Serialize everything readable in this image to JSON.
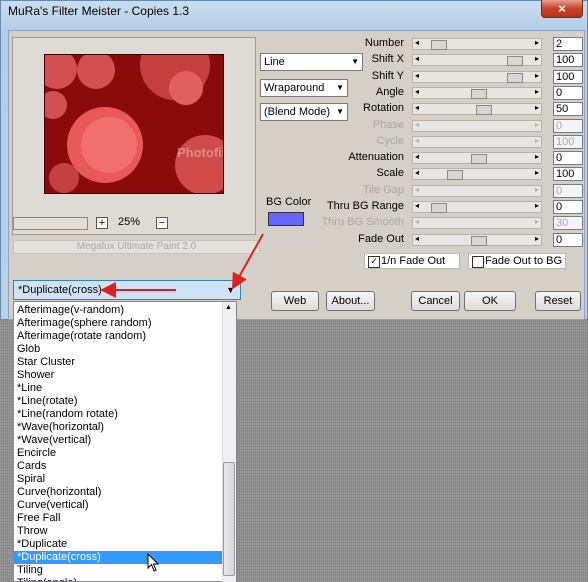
{
  "window": {
    "title": "MuRa's Filter Meister - Copies 1.3",
    "close_glyph": "×"
  },
  "preview": {
    "watermark": "PhotofiltreGraphic",
    "zoom_value": "25%",
    "zoom_plus": "+",
    "zoom_minus": "−",
    "caption": "Megalux Ultimate Paint 2.0"
  },
  "selects": {
    "mode": "Line",
    "edge": "Wraparound",
    "blend": "(Blend Mode)"
  },
  "bg_color": {
    "label": "BG Color",
    "color": "#6666ff"
  },
  "params": [
    {
      "label": "Number",
      "value": "2",
      "pos": 0.08,
      "disabled": false
    },
    {
      "label": "Shift X",
      "value": "100",
      "pos": 0.88,
      "disabled": false
    },
    {
      "label": "Shift Y",
      "value": "100",
      "pos": 0.88,
      "disabled": false
    },
    {
      "label": "Angle",
      "value": "0",
      "pos": 0.5,
      "disabled": false
    },
    {
      "label": "Rotation",
      "value": "50",
      "pos": 0.55,
      "disabled": false
    },
    {
      "label": "Phase",
      "value": "0",
      "pos": null,
      "disabled": true
    },
    {
      "label": "Cycle",
      "value": "100",
      "pos": null,
      "disabled": true
    },
    {
      "label": "Attenuation",
      "value": "0",
      "pos": 0.5,
      "disabled": false
    },
    {
      "label": "Scale",
      "value": "100",
      "pos": 0.25,
      "disabled": false
    },
    {
      "label": "Tile Gap",
      "value": "0",
      "pos": null,
      "disabled": true
    },
    {
      "label": "Thru BG Range",
      "value": "0",
      "pos": 0.08,
      "disabled": false
    },
    {
      "label": "Thru BG Smooth",
      "value": "30",
      "pos": null,
      "disabled": true
    },
    {
      "label": "Fade Out",
      "value": "0",
      "pos": 0.5,
      "disabled": false
    }
  ],
  "checkboxes": {
    "one_n_fade": {
      "label": "1/n Fade Out",
      "checked": true,
      "mark": "✓"
    },
    "fade_to_bg": {
      "label": "Fade Out to BG",
      "checked": false,
      "mark": ""
    }
  },
  "buttons": {
    "web": "Web",
    "about": "About...",
    "cancel": "Cancel",
    "ok": "OK",
    "reset": "Reset"
  },
  "preset_dropdown": {
    "selected": "*Duplicate(cross)"
  },
  "preset_list": [
    "Afterimage(v-random)",
    "Afterimage(sphere random)",
    "Afterimage(rotate random)",
    "Glob",
    "Star Cluster",
    "Shower",
    "*Line",
    "*Line(rotate)",
    "*Line(random rotate)",
    "*Wave(horizontal)",
    "*Wave(vertical)",
    "Encircle",
    "Cards",
    "Spiral",
    "Curve(horizontal)",
    "Curve(vertical)",
    "Free Fall",
    "Throw",
    "*Duplicate",
    "*Duplicate(cross)",
    "Tiling",
    "Tiling(angle)"
  ],
  "selected_index": 19,
  "colors": {
    "accent_arrow": "#e02020",
    "selection": "#3399ff"
  }
}
